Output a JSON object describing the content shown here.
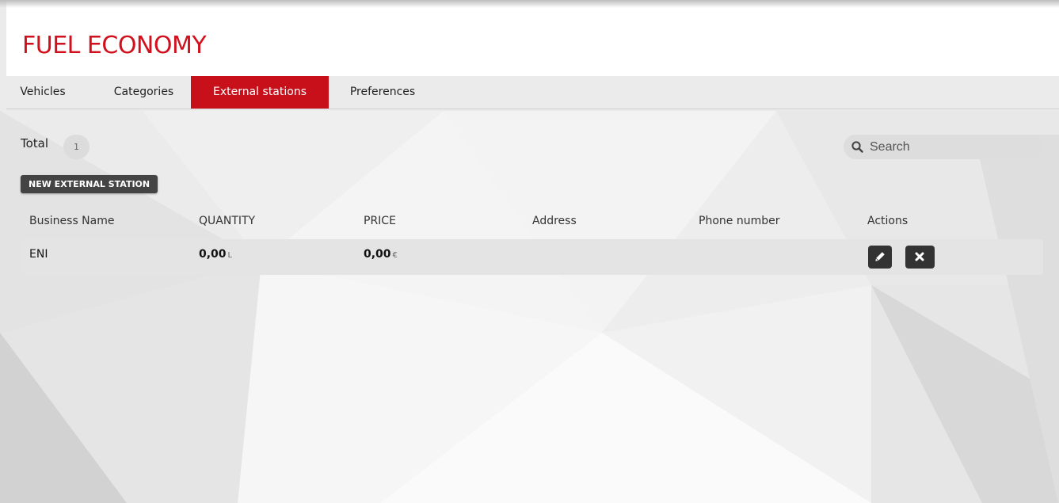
{
  "app": {
    "title": "FUEL ECONOMY"
  },
  "tabs": [
    {
      "label": "Vehicles",
      "active": false
    },
    {
      "label": "Categories",
      "active": false
    },
    {
      "label": "External stations",
      "active": true
    },
    {
      "label": "Preferences",
      "active": false
    }
  ],
  "summary": {
    "total_label": "Total",
    "total_count": "1"
  },
  "search": {
    "placeholder": "Search",
    "icon": "search-icon"
  },
  "actions": {
    "new_label": "NEW EXTERNAL STATION"
  },
  "table": {
    "columns": [
      "Business Name",
      "QUANTITY",
      "PRICE",
      "Address",
      "Phone number",
      "Actions"
    ],
    "rows": [
      {
        "business_name": "ENI",
        "quantity": "0,00",
        "quantity_unit": "L",
        "price": "0,00",
        "price_unit": "€",
        "address": "",
        "phone": "",
        "row_actions": [
          "pencil-icon",
          "close-icon"
        ]
      }
    ]
  },
  "colors": {
    "brand": "#c8101b",
    "button_dark": "#333333"
  }
}
